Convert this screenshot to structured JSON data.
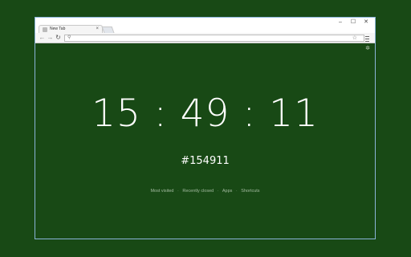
{
  "browser": {
    "tab_title": "New Tab",
    "tab_close": "×",
    "controls": {
      "minimize": "–",
      "maximize": "☐",
      "close": "✕"
    },
    "nav": {
      "back": "←",
      "forward": "→",
      "reload": "↻"
    },
    "omnibox_value": "",
    "icons": {
      "search": "search-icon",
      "star": "star-icon",
      "menu": "menu-icon",
      "settings": "gear-icon"
    }
  },
  "page": {
    "clock": "15 : 49 : 11",
    "hex_color": "#154911",
    "background_color": "#184915",
    "links": [
      "Most visited",
      "Recently closed",
      "Apps",
      "Shortcuts"
    ],
    "separator": "·"
  }
}
